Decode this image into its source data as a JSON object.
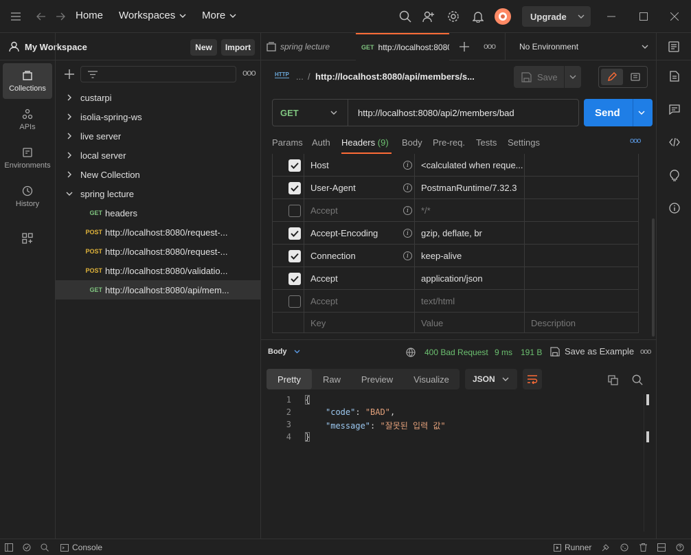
{
  "titlebar": {
    "home": "Home",
    "workspaces": "Workspaces",
    "more": "More",
    "upgrade": "Upgrade"
  },
  "workspace": {
    "name": "My Workspace",
    "new_label": "New",
    "import_label": "Import"
  },
  "rail": {
    "items": [
      {
        "label": "Collections",
        "icon": "collections-icon"
      },
      {
        "label": "APIs",
        "icon": "apis-icon"
      },
      {
        "label": "Environments",
        "icon": "environments-icon"
      },
      {
        "label": "History",
        "icon": "history-icon"
      }
    ]
  },
  "sidebar": {
    "collections": [
      "custarpi",
      "isolia-spring-ws",
      "live server",
      "local server",
      "New Collection",
      "spring lecture"
    ],
    "requests": [
      {
        "method": "GET",
        "name": "headers"
      },
      {
        "method": "POST",
        "name": "http://localhost:8080/request-..."
      },
      {
        "method": "POST",
        "name": "http://localhost:8080/request-..."
      },
      {
        "method": "POST",
        "name": "http://localhost:8080/validatio..."
      },
      {
        "method": "GET",
        "name": "http://localhost:8080/api/mem..."
      }
    ]
  },
  "tabs": {
    "tab1": "spring lecture",
    "tab2_method": "GET",
    "tab2_url": "http://localhost:8080",
    "environment": "No Environment"
  },
  "request": {
    "breadcrumb_ellipsis": "...",
    "breadcrumb_sep": "/",
    "breadcrumb_title": "http://localhost:8080/api/members/s...",
    "http_badge": "HTTP",
    "save": "Save",
    "method": "GET",
    "url": "http://localhost:8080/api2/members/bad",
    "send": "Send",
    "subtabs": [
      "Params",
      "Auth",
      "Headers",
      "Body",
      "Pre-req.",
      "Tests",
      "Settings"
    ],
    "headers_count": "(9)",
    "more": "ooo"
  },
  "headers": {
    "rows": [
      {
        "key": "Host",
        "value": "<calculated when reque...",
        "checked": true,
        "info": true,
        "disabled": false
      },
      {
        "key": "User-Agent",
        "value": "PostmanRuntime/7.32.3",
        "checked": true,
        "info": true,
        "disabled": false
      },
      {
        "key": "Accept",
        "value": "*/*",
        "checked": false,
        "info": true,
        "disabled": true
      },
      {
        "key": "Accept-Encoding",
        "value": "gzip, deflate, br",
        "checked": true,
        "info": true,
        "disabled": false
      },
      {
        "key": "Connection",
        "value": "keep-alive",
        "checked": true,
        "info": true,
        "disabled": false
      },
      {
        "key": "Accept",
        "value": "application/json",
        "checked": true,
        "info": false,
        "disabled": false
      },
      {
        "key": "Accept",
        "value": "text/html",
        "checked": false,
        "info": false,
        "disabled": true
      }
    ],
    "placeholder_key": "Key",
    "placeholder_value": "Value",
    "placeholder_description": "Description"
  },
  "response": {
    "body_label": "Body",
    "status": "400 Bad Request",
    "time": "9 ms",
    "size": "191 B",
    "save_example": "Save as Example",
    "tabs": [
      "Pretty",
      "Raw",
      "Preview",
      "Visualize"
    ],
    "format": "JSON",
    "lines": [
      {
        "num": "1",
        "text": "{"
      },
      {
        "num": "2",
        "key": "\"code\"",
        "colon": ": ",
        "value": "\"BAD\"",
        "tail": ","
      },
      {
        "num": "3",
        "key": "\"message\"",
        "colon": ": ",
        "value": "\"잘못된 입력 값\"",
        "tail": ""
      },
      {
        "num": "4",
        "text": "}"
      }
    ]
  },
  "statusbar": {
    "console": "Console",
    "runner": "Runner"
  },
  "colors": {
    "accent": "#ff6c37",
    "send": "#1f7ee6",
    "status_ok": "#6cc070",
    "get": "#7fc47f",
    "post": "#e0b33a"
  }
}
